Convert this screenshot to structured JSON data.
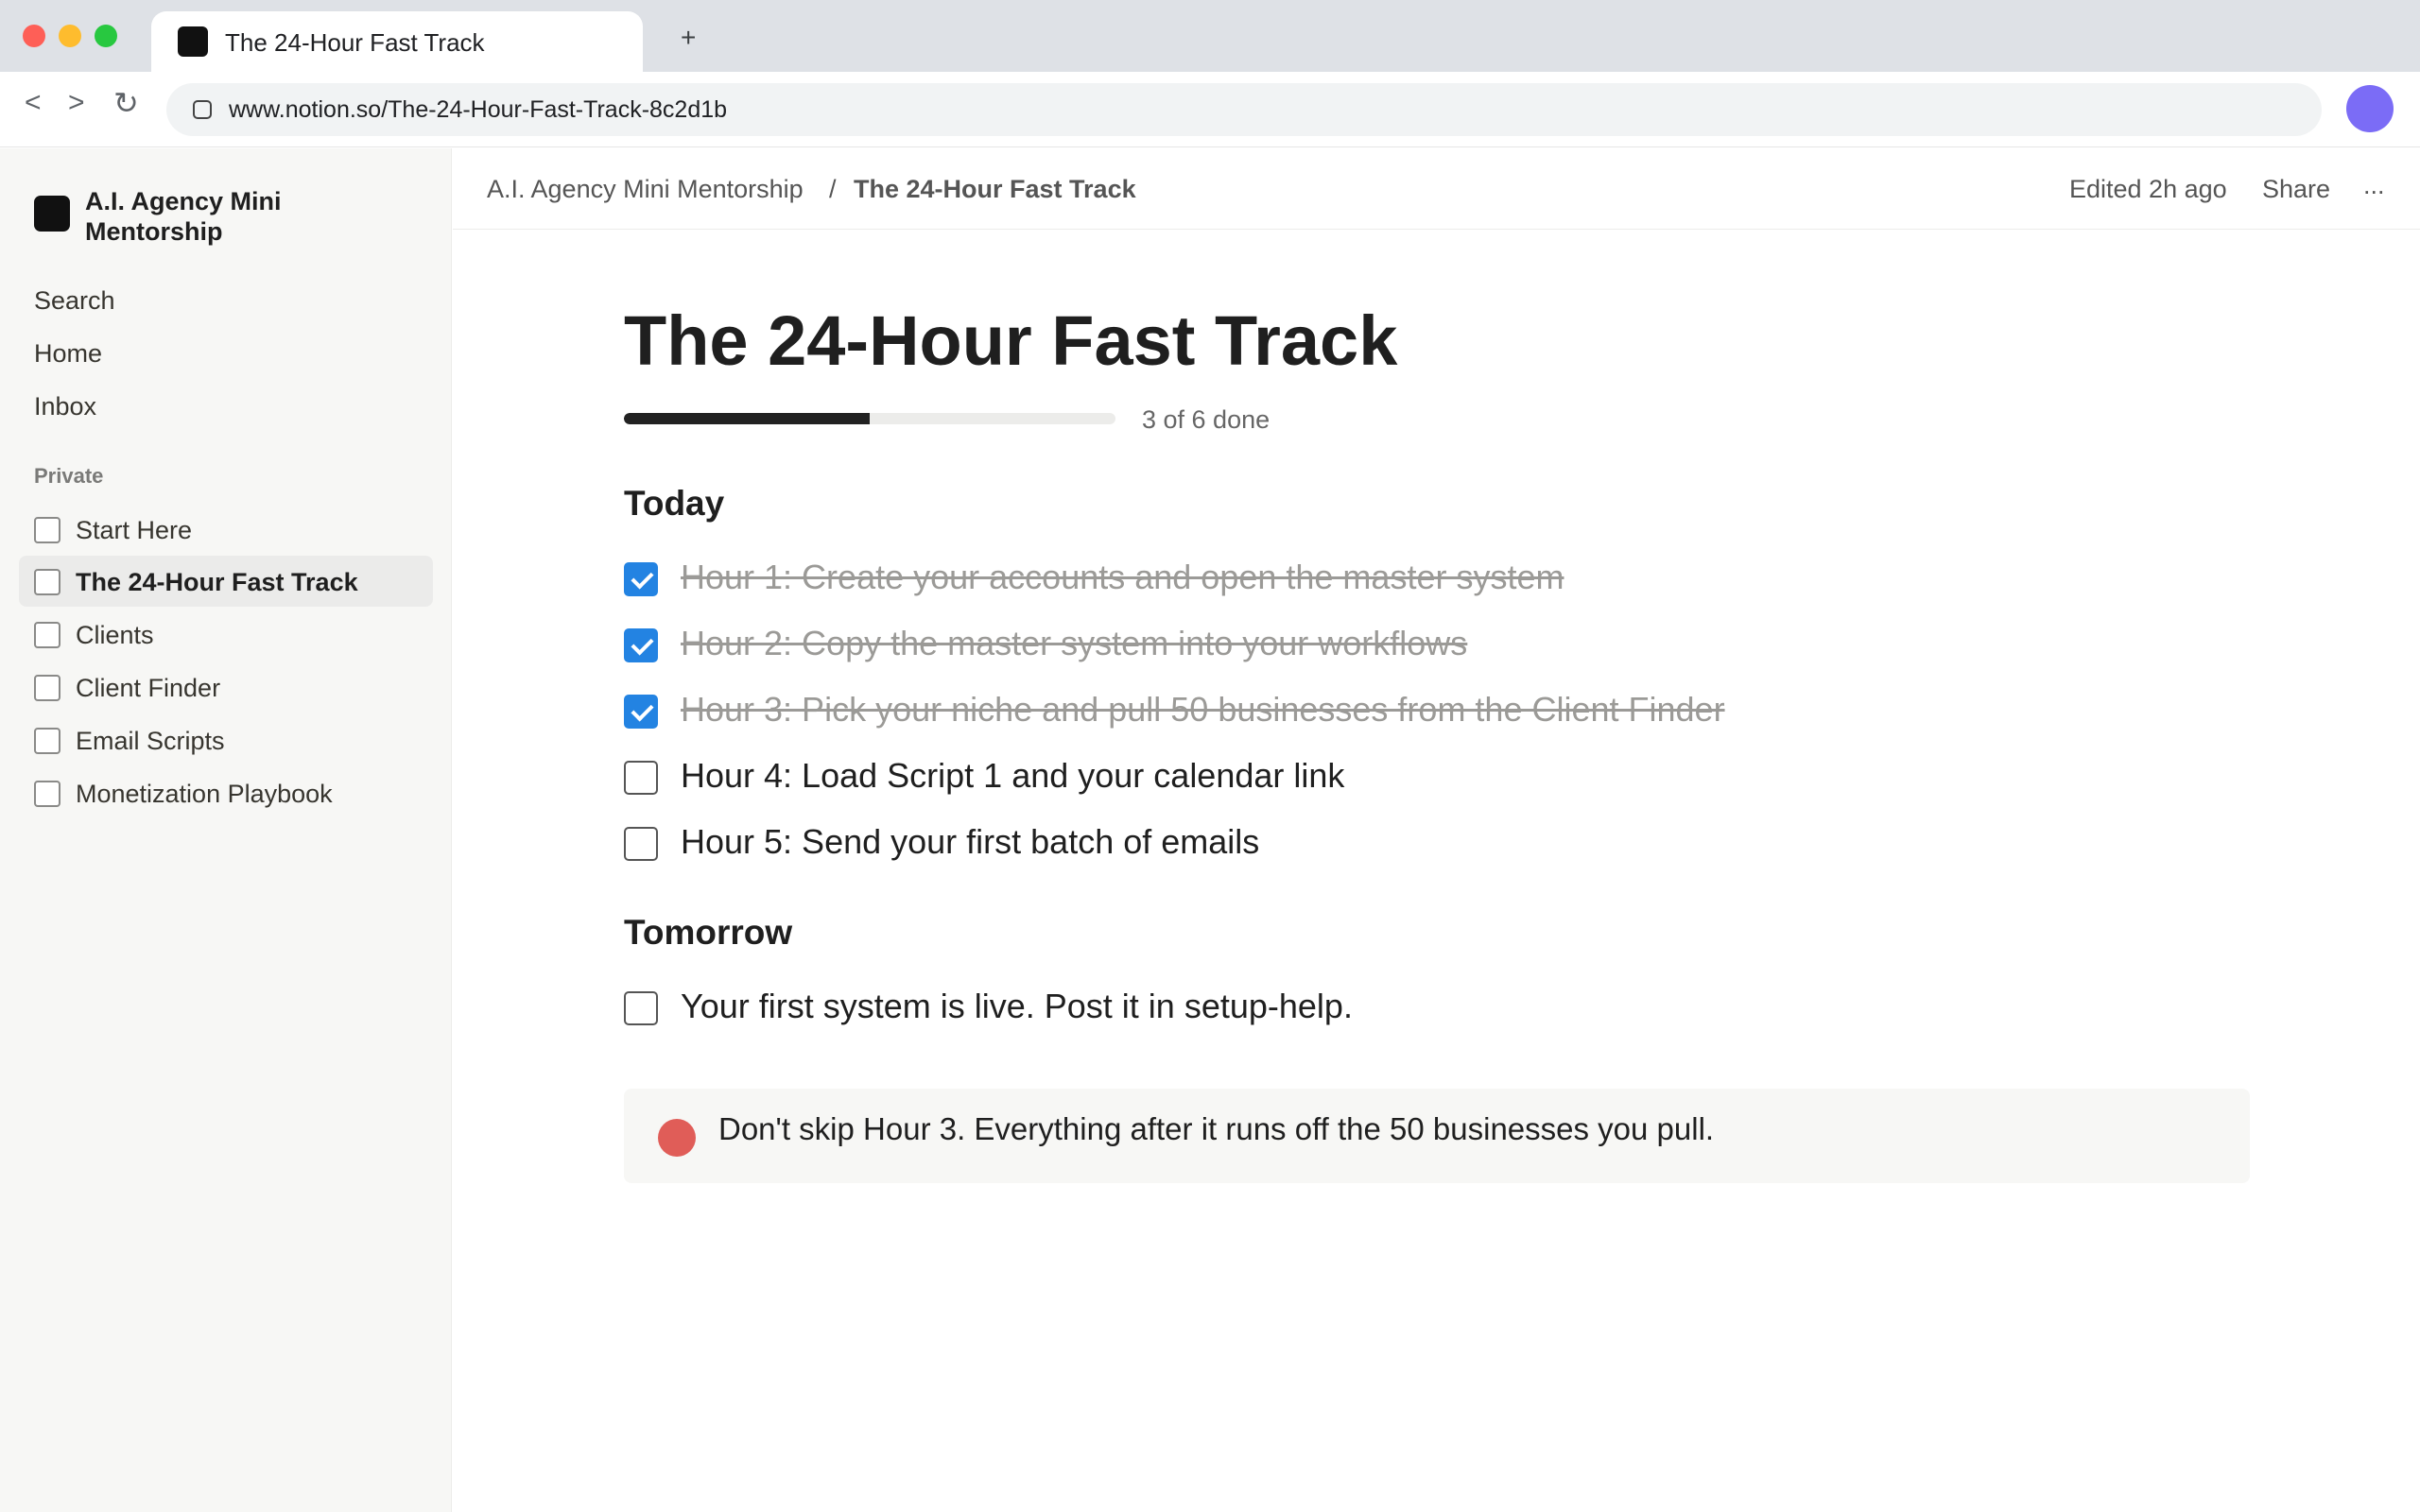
{
  "browser": {
    "tab_title": "The 24-Hour Fast Track",
    "new_tab": "+",
    "back": "<",
    "forward": ">",
    "reload": "↻",
    "url": "www.notion.so/The-24-Hour-Fast-Track-8c2d1b"
  },
  "sidebar": {
    "workspace_name": "A.I. Agency Mini Mentorship",
    "nav": [
      "Search",
      "Home",
      "Inbox"
    ],
    "section_label": "Private",
    "pages": [
      {
        "label": "Start Here",
        "active": false
      },
      {
        "label": "The 24-Hour Fast Track",
        "active": true
      },
      {
        "label": "Clients",
        "active": false
      },
      {
        "label": "Client Finder",
        "active": false
      },
      {
        "label": "Email Scripts",
        "active": false
      },
      {
        "label": "Monetization Playbook",
        "active": false
      }
    ]
  },
  "topbar": {
    "breadcrumb": [
      "A.I. Agency Mini Mentorship",
      "The 24-Hour Fast Track"
    ],
    "separator": "/",
    "edited": "Edited 2h ago",
    "share": "Share",
    "more": "..."
  },
  "page": {
    "title": "The 24-Hour Fast Track",
    "progress": {
      "done": 3,
      "total": 6,
      "label": "3 of 6 done"
    },
    "sections": [
      {
        "heading": "Today",
        "todos": [
          {
            "text": "Hour 1: Create your accounts and open the master system",
            "checked": true
          },
          {
            "text": "Hour 2: Copy the master system into your workflows",
            "checked": true
          },
          {
            "text": "Hour 3: Pick your niche and pull 50 businesses from the Client Finder",
            "checked": true
          },
          {
            "text": "Hour 4: Load Script 1 and your calendar link",
            "checked": false
          },
          {
            "text": "Hour 5: Send your first batch of emails",
            "checked": false
          }
        ]
      },
      {
        "heading": "Tomorrow",
        "todos": [
          {
            "text": "Your first system is live. Post it in setup-help.",
            "checked": false
          }
        ]
      }
    ],
    "callout": {
      "icon": "red-circle-icon",
      "icon_color": "#e05d58",
      "text": "Don't skip Hour 3. Everything after it runs off the 50 businesses you pull."
    }
  },
  "colors": {
    "accent": "#2383e2",
    "profile": "#7b6cf6"
  }
}
